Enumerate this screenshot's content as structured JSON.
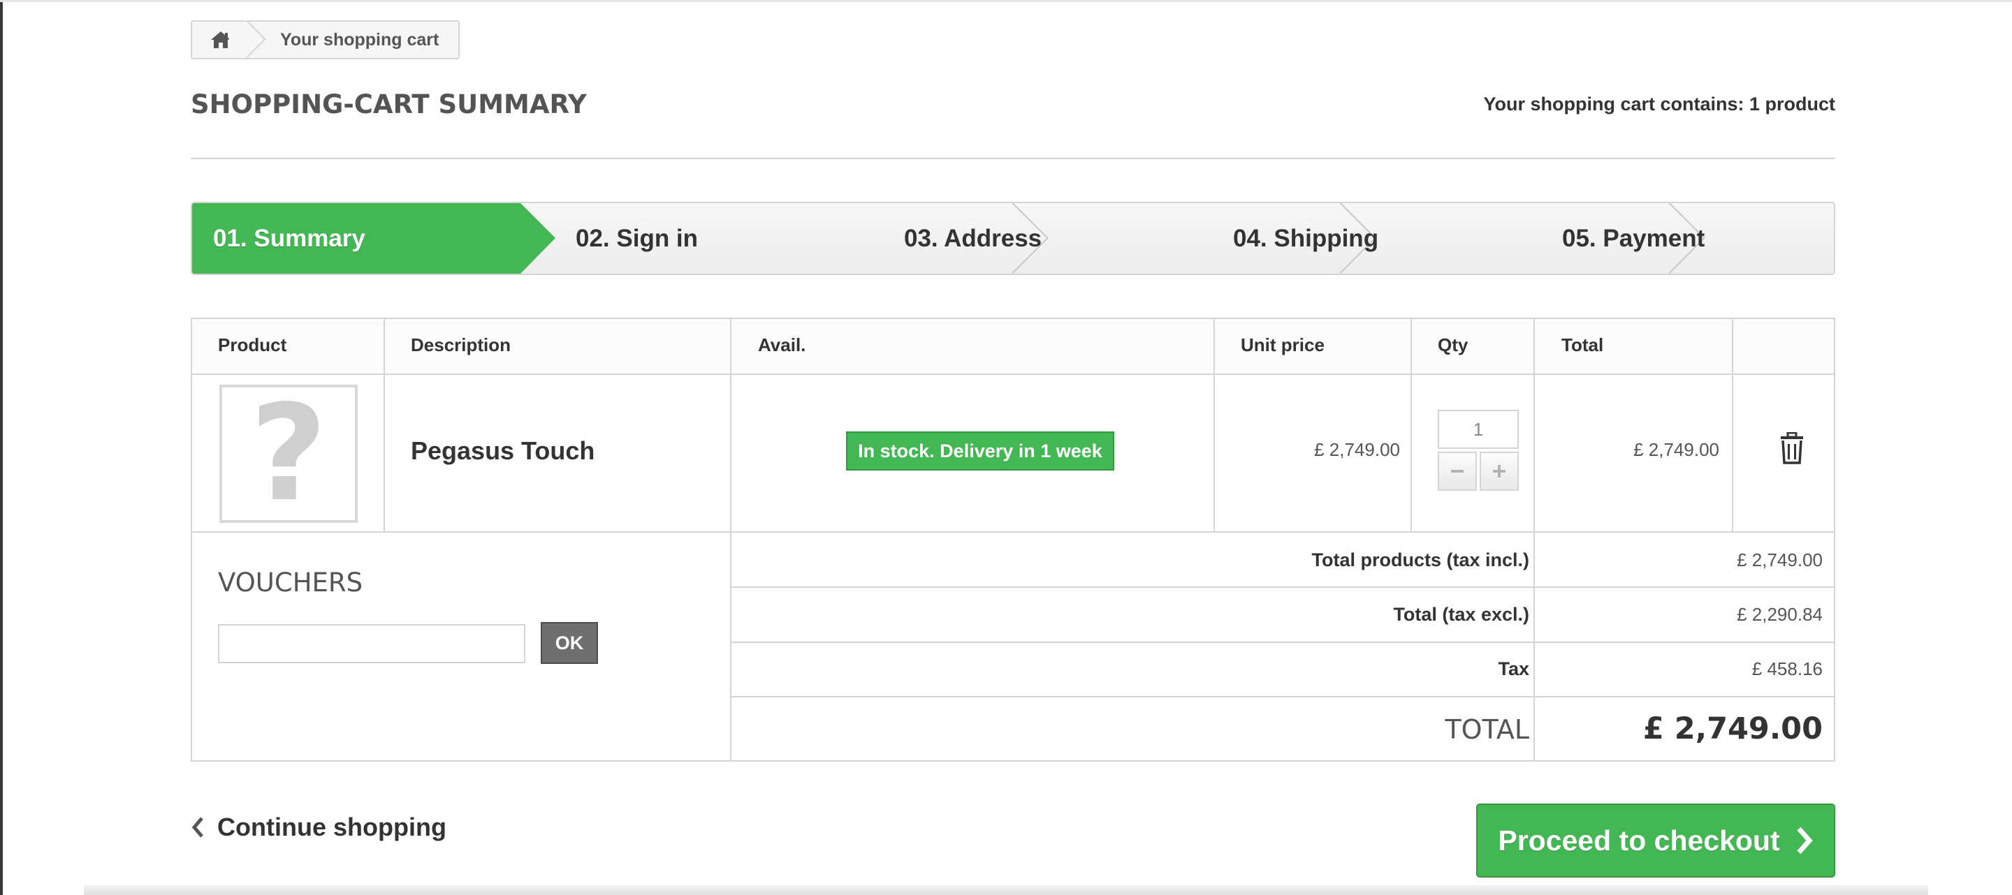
{
  "breadcrumb": {
    "home_icon": "home-icon",
    "current": "Your shopping cart"
  },
  "page": {
    "title": "SHOPPING-CART SUMMARY",
    "cart_count": "Your shopping cart contains: 1 product"
  },
  "steps": [
    {
      "label": "01. Summary",
      "active": true
    },
    {
      "label": "02. Sign in",
      "active": false
    },
    {
      "label": "03. Address",
      "active": false
    },
    {
      "label": "04. Shipping",
      "active": false
    },
    {
      "label": "05. Payment",
      "active": false
    }
  ],
  "table": {
    "headers": [
      "Product",
      "Description",
      "Avail.",
      "Unit price",
      "Qty",
      "Total"
    ],
    "rows": [
      {
        "image_icon": "question-mark-placeholder",
        "name": "Pegasus Touch",
        "availability": "In stock. Delivery in 1 week",
        "unit_price": "£ 2,749.00",
        "qty": "1",
        "total": "£ 2,749.00",
        "delete_icon": "trash-icon"
      }
    ]
  },
  "vouchers": {
    "title": "VOUCHERS",
    "input_value": "",
    "ok_label": "OK"
  },
  "summary": {
    "total_products_label": "Total products (tax incl.)",
    "total_products_value": "£ 2,749.00",
    "total_excl_label": "Total (tax excl.)",
    "total_excl_value": "£ 2,290.84",
    "tax_label": "Tax",
    "tax_value": "£ 458.16",
    "grand_total_label": "TOTAL",
    "grand_total_value": "£ 2,749.00"
  },
  "actions": {
    "continue_label": "Continue shopping",
    "checkout_label": "Proceed to checkout"
  },
  "colors": {
    "accent_green": "#43b754",
    "border_grey": "#d6d4d4",
    "ok_button": "#6f6f6f"
  }
}
